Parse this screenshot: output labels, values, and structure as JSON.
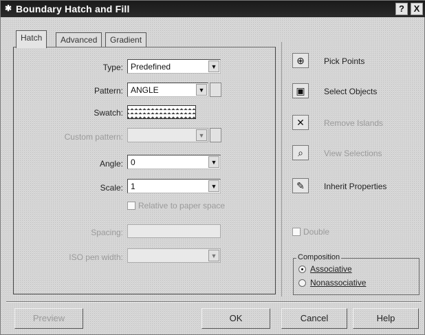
{
  "window": {
    "title": "Boundary Hatch and Fill",
    "help_glyph": "?",
    "close_glyph": "X"
  },
  "tabs": [
    {
      "label": "Hatch"
    },
    {
      "label": "Advanced"
    },
    {
      "label": "Gradient"
    }
  ],
  "hatch": {
    "type": {
      "label": "Type:",
      "value": "Predefined"
    },
    "pattern": {
      "label": "Pattern:",
      "value": "ANGLE"
    },
    "swatch": {
      "label": "Swatch:"
    },
    "custom_pattern": {
      "label": "Custom pattern:",
      "value": ""
    },
    "angle": {
      "label": "Angle:",
      "value": "0"
    },
    "scale": {
      "label": "Scale:",
      "value": "1"
    },
    "relative_paper": {
      "label": "Relative to paper space",
      "checked": false
    },
    "spacing": {
      "label": "Spacing:",
      "value": ""
    },
    "iso_pen": {
      "label": "ISO pen width:",
      "value": ""
    }
  },
  "actions": [
    {
      "label": "Pick Points",
      "icon": "pick-points-icon",
      "enabled": true
    },
    {
      "label": "Select Objects",
      "icon": "select-objects-icon",
      "enabled": true
    },
    {
      "label": "Remove Islands",
      "icon": "remove-islands-icon",
      "enabled": false
    },
    {
      "label": "View Selections",
      "icon": "view-selections-icon",
      "enabled": false
    },
    {
      "label": "Inherit Properties",
      "icon": "inherit-properties-icon",
      "enabled": true
    }
  ],
  "double": {
    "label": "Double",
    "checked": false
  },
  "composition": {
    "title": "Composition",
    "options": [
      {
        "label": "Associative",
        "selected": true
      },
      {
        "label": "Nonassociative",
        "selected": false
      }
    ]
  },
  "buttons": {
    "preview": "Preview",
    "ok": "OK",
    "cancel": "Cancel",
    "help": "Help"
  }
}
